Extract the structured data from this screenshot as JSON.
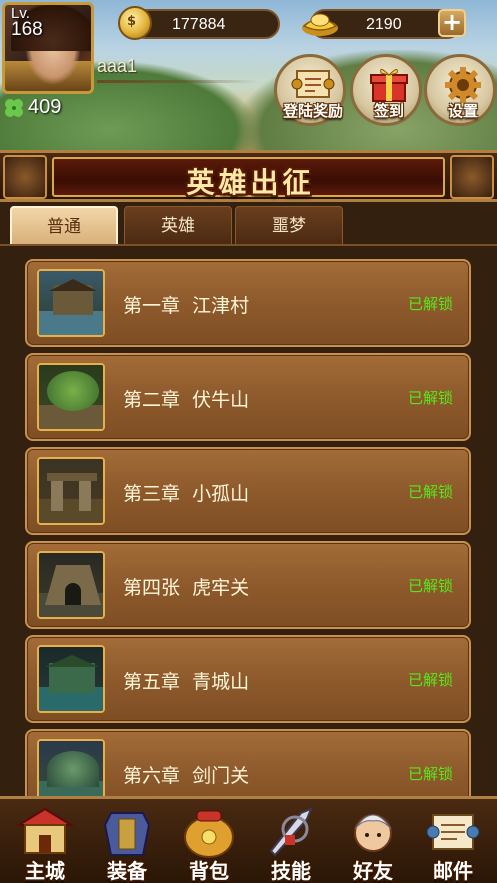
{
  "player": {
    "level_label": "Lv.",
    "level": "168",
    "name": "aaa1",
    "stamina": "409"
  },
  "resources": {
    "coins": "177884",
    "coin_glyph": "$",
    "gold": "2190"
  },
  "quick_actions": [
    {
      "label": "登陆奖励",
      "icon": "scroll-icon"
    },
    {
      "label": "签到",
      "icon": "gift-box-icon"
    },
    {
      "label": "设置",
      "icon": "gear-icon"
    }
  ],
  "banner": {
    "title": "英雄出征"
  },
  "tabs": [
    {
      "label": "普通",
      "active": true
    },
    {
      "label": "英雄",
      "active": false
    },
    {
      "label": "噩梦",
      "active": false
    }
  ],
  "chapters": [
    {
      "title": "第一章  江津村",
      "status": "已解锁"
    },
    {
      "title": "第二章  伏牛山",
      "status": "已解锁"
    },
    {
      "title": "第三章  小孤山",
      "status": "已解锁"
    },
    {
      "title": "第四张  虎牢关",
      "status": "已解锁"
    },
    {
      "title": "第五章  青城山",
      "status": "已解锁"
    },
    {
      "title": "第六章  剑门关",
      "status": "已解锁"
    }
  ],
  "bottom_nav": [
    {
      "label": "主城",
      "icon": "castle-icon"
    },
    {
      "label": "装备",
      "icon": "armor-icon"
    },
    {
      "label": "背包",
      "icon": "bag-icon"
    },
    {
      "label": "技能",
      "icon": "sword-skill-icon"
    },
    {
      "label": "好友",
      "icon": "friend-icon"
    },
    {
      "label": "邮件",
      "icon": "mail-scroll-icon"
    }
  ],
  "colors": {
    "unlocked_status": "#57e81a",
    "banner_text": "#ffe9a8",
    "frame_gold": "#c69a3a"
  }
}
